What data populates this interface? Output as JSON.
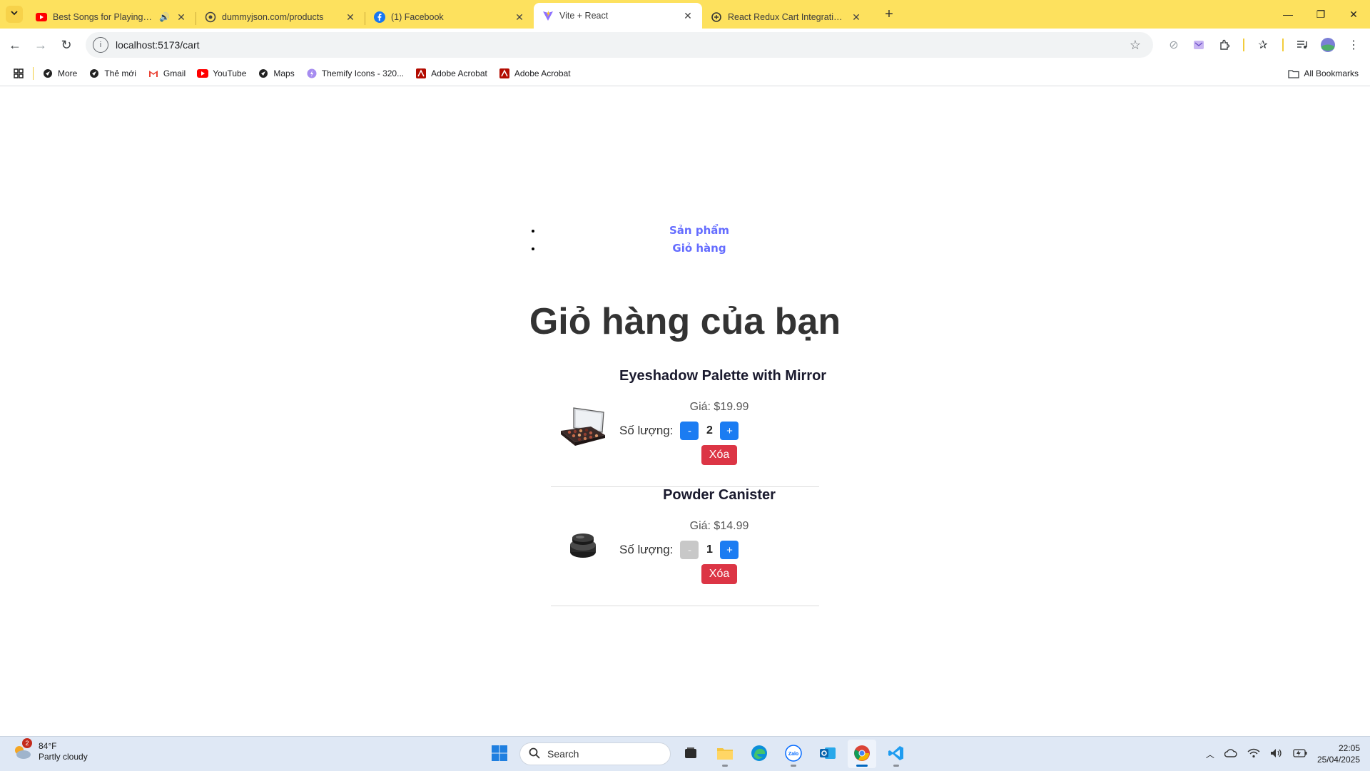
{
  "browser": {
    "tabs": [
      {
        "title": "Best Songs for Playing LOL",
        "favicon": "youtube-icon",
        "audio": true,
        "active": false
      },
      {
        "title": "dummyjson.com/products",
        "favicon": "globe-icon",
        "active": false
      },
      {
        "title": "(1) Facebook",
        "favicon": "facebook-icon",
        "active": false
      },
      {
        "title": "Vite + React",
        "favicon": "vite-icon",
        "active": true
      },
      {
        "title": "React Redux Cart Integration Is",
        "favicon": "openai-icon",
        "active": false
      }
    ],
    "url": "localhost:5173/cart",
    "bookmarks": [
      {
        "label": "More",
        "icon": "globe-icon"
      },
      {
        "label": "Thẻ mới",
        "icon": "globe-icon"
      },
      {
        "label": "Gmail",
        "icon": "gmail-icon"
      },
      {
        "label": "YouTube",
        "icon": "youtube-icon"
      },
      {
        "label": "Maps",
        "icon": "globe-icon"
      },
      {
        "label": "Themify Icons - 320...",
        "icon": "themify-icon"
      },
      {
        "label": "Adobe Acrobat",
        "icon": "acrobat-icon"
      },
      {
        "label": "Adobe Acrobat",
        "icon": "acrobat-icon"
      }
    ],
    "all_bookmarks": "All Bookmarks"
  },
  "page": {
    "nav": [
      {
        "label": "Sản phẩm"
      },
      {
        "label": "Giỏ hàng"
      }
    ],
    "title": "Giỏ hàng của bạn",
    "price_label": "Giá:",
    "qty_label": "Số lượng:",
    "minus": "-",
    "plus": "+",
    "remove_label": "Xóa",
    "items": [
      {
        "name": "Eyeshadow Palette with Mirror",
        "price": "$19.99",
        "quantity": "2",
        "minus_disabled": false,
        "image": "eyeshadow-palette-image"
      },
      {
        "name": "Powder Canister",
        "price": "$14.99",
        "quantity": "1",
        "minus_disabled": true,
        "image": "powder-canister-image"
      }
    ]
  },
  "taskbar": {
    "weather_temp": "84°F",
    "weather_desc": "Partly cloudy",
    "weather_badge": "2",
    "search_placeholder": "Search",
    "time": "22:05",
    "date": "25/04/2025"
  },
  "colors": {
    "tabstrip": "#fde15e",
    "link": "#646cff",
    "qty_button": "#1b7cf2",
    "remove_button": "#dc3545"
  }
}
